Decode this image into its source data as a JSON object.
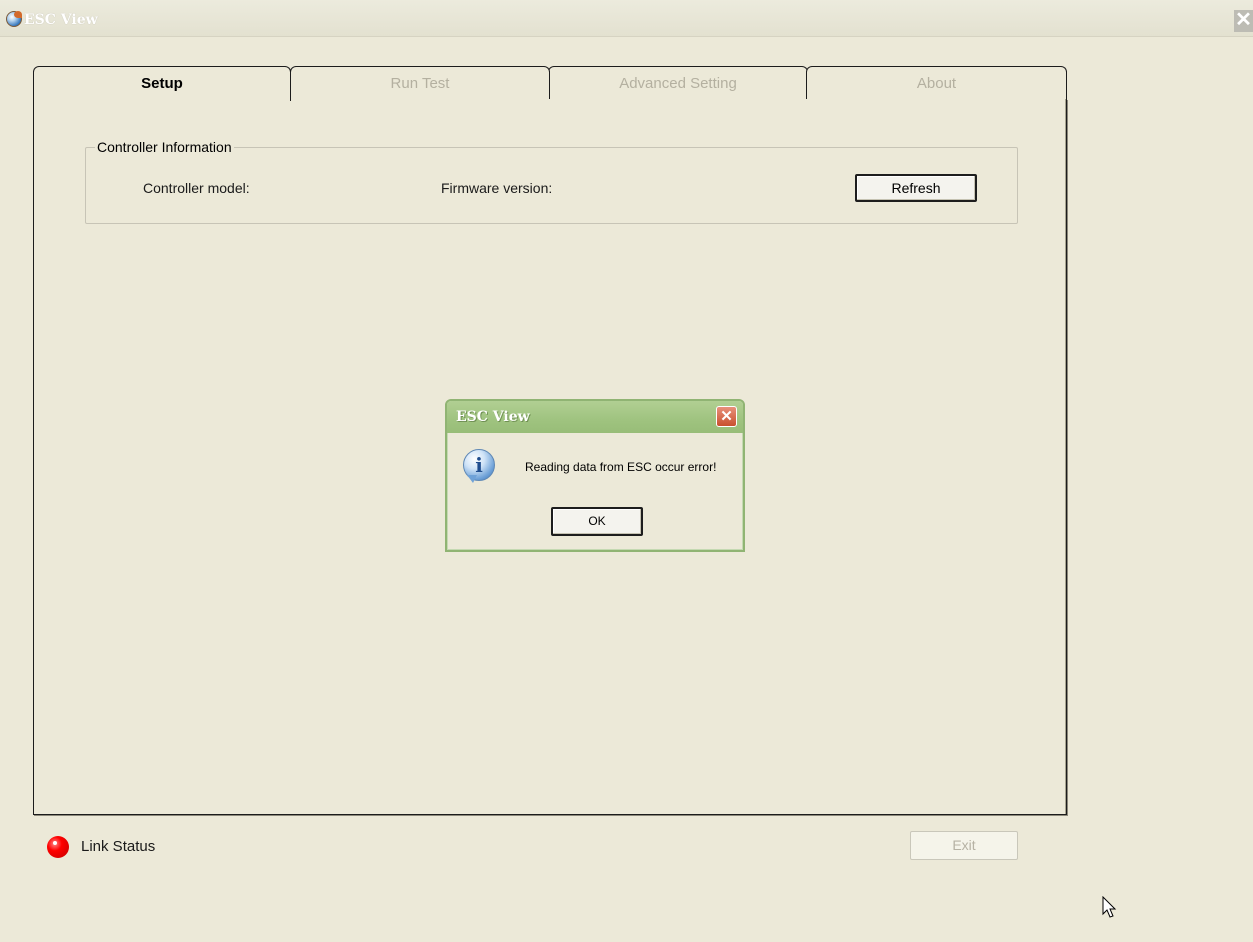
{
  "window": {
    "title": "ESC View",
    "close_glyph": "✕"
  },
  "tabs": [
    {
      "label": "Setup",
      "active": true
    },
    {
      "label": "Run Test",
      "active": false
    },
    {
      "label": "Advanced Setting",
      "active": false
    },
    {
      "label": "About",
      "active": false
    }
  ],
  "setup": {
    "group_title": "Controller Information",
    "controller_model_label": "Controller model:",
    "firmware_version_label": "Firmware version:",
    "refresh_label": "Refresh"
  },
  "dialog": {
    "title": "ESC View",
    "message": "Reading data from ESC occur error!",
    "ok_label": "OK",
    "icon": "info-icon",
    "close_glyph": "✕"
  },
  "footer": {
    "link_status_label": "Link Status",
    "link_status_color": "#ff0000",
    "exit_label": "Exit"
  }
}
